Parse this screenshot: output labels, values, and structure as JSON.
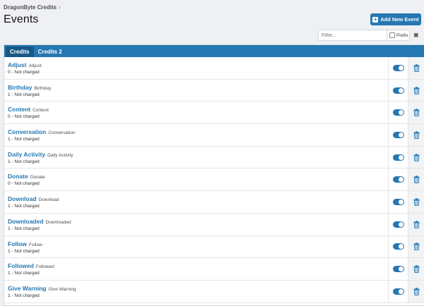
{
  "breadcrumb": {
    "item": "DragonByte Credits",
    "separator": "›"
  },
  "page": {
    "title": "Events"
  },
  "add_button": {
    "label": "Add New Event"
  },
  "filter": {
    "placeholder": "Filter...",
    "prefix_label": "Prefix",
    "clear_glyph": "✖"
  },
  "tabs": [
    {
      "label": "Credits",
      "active": true
    },
    {
      "label": "Credits 2",
      "active": false
    }
  ],
  "events": [
    {
      "name": "Adjust",
      "sub": "Adjust",
      "desc": "0 - Not charged",
      "enabled": true
    },
    {
      "name": "Birthday",
      "sub": "Birthday",
      "desc": "1 - Not charged",
      "enabled": true
    },
    {
      "name": "Content",
      "sub": "Content",
      "desc": "0 - Not charged",
      "enabled": true
    },
    {
      "name": "Conversation",
      "sub": "Conversation",
      "desc": "1 - Not charged",
      "enabled": true
    },
    {
      "name": "Daily Activity",
      "sub": "Daily Activity",
      "desc": "1 - Not charged",
      "enabled": true
    },
    {
      "name": "Donate",
      "sub": "Donate",
      "desc": "0 - Not charged",
      "enabled": true
    },
    {
      "name": "Download",
      "sub": "Download",
      "desc": "1 - Not charged",
      "enabled": true
    },
    {
      "name": "Downloaded",
      "sub": "Downloaded",
      "desc": "1 - Not charged",
      "enabled": true
    },
    {
      "name": "Follow",
      "sub": "Follow",
      "desc": "1 - Not charged",
      "enabled": true
    },
    {
      "name": "Followed",
      "sub": "Followed",
      "desc": "1 - Not charged",
      "enabled": true
    },
    {
      "name": "Give Warning",
      "sub": "Give Warning",
      "desc": "1 - Not charged",
      "enabled": true
    }
  ],
  "colors": {
    "accent": "#2577b1",
    "tab_active": "#185886",
    "background": "#eef0f3"
  }
}
